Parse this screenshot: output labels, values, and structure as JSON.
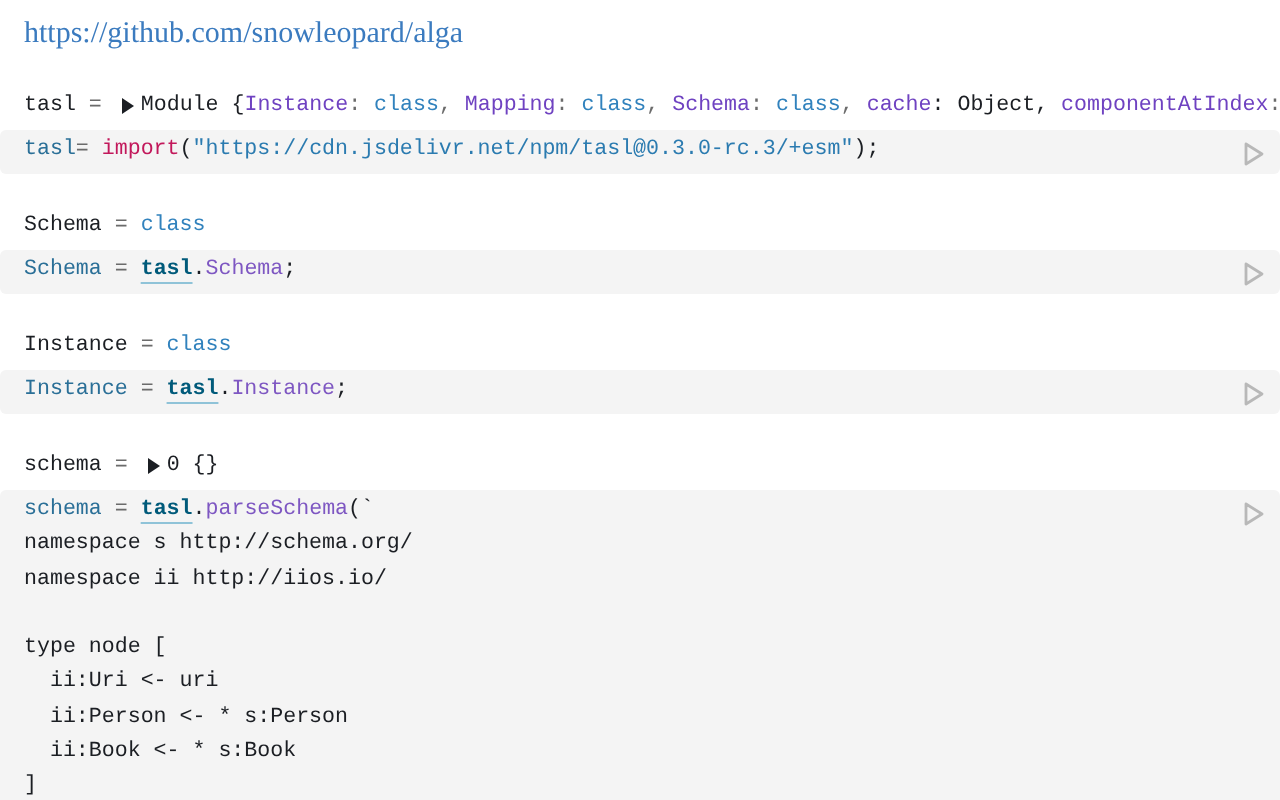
{
  "link": "https://github.com/snowleopard/alga",
  "cells": [
    {
      "output": {
        "label": [
          {
            "text": "tasl",
            "kind": "plain"
          },
          {
            "text": " = ",
            "kind": "op"
          }
        ],
        "expanded": false,
        "value": [
          {
            "text": "Module {",
            "kind": "plain"
          },
          {
            "text": "Instance",
            "kind": "key"
          },
          {
            "text": ": ",
            "kind": "op"
          },
          {
            "text": "class",
            "kind": "value"
          },
          {
            "text": ", ",
            "kind": "op"
          },
          {
            "text": "Mapping",
            "kind": "key"
          },
          {
            "text": ": ",
            "kind": "op"
          },
          {
            "text": "class",
            "kind": "value"
          },
          {
            "text": ", ",
            "kind": "op"
          },
          {
            "text": "Schema",
            "kind": "key"
          },
          {
            "text": ": ",
            "kind": "op"
          },
          {
            "text": "class",
            "kind": "value"
          },
          {
            "text": ", ",
            "kind": "op"
          },
          {
            "text": "cache",
            "kind": "key"
          },
          {
            "text": ": Object, ",
            "kind": "plain"
          },
          {
            "text": "componentAtIndex",
            "kind": "key"
          },
          {
            "text": ":",
            "kind": "op"
          }
        ]
      },
      "code": [
        [
          [
            {
              "text": "tasl",
              "kind": "var"
            },
            {
              "text": "= ",
              "kind": "op"
            },
            {
              "text": "import",
              "kind": "keyword"
            },
            {
              "text": "(",
              "kind": "plain"
            },
            {
              "text": "\"https://cdn.jsdelivr.net/npm/tasl@0.3.0-rc.3/+esm\"",
              "kind": "string"
            },
            {
              "text": ");",
              "kind": "plain"
            }
          ]
        ]
      ]
    },
    {
      "output": {
        "label": [
          {
            "text": "Schema",
            "kind": "plain"
          },
          {
            "text": " = ",
            "kind": "op"
          }
        ],
        "value": [
          {
            "text": "class",
            "kind": "value"
          }
        ]
      },
      "code": [
        [
          [
            {
              "text": "Schema",
              "kind": "var"
            },
            {
              "text": " = ",
              "kind": "op"
            },
            {
              "text": "tasl",
              "kind": "ref"
            },
            {
              "text": ".",
              "kind": "plain"
            },
            {
              "text": "Schema",
              "kind": "prop"
            },
            {
              "text": ";",
              "kind": "plain"
            }
          ]
        ]
      ]
    },
    {
      "output": {
        "label": [
          {
            "text": "Instance",
            "kind": "plain"
          },
          {
            "text": " = ",
            "kind": "op"
          }
        ],
        "value": [
          {
            "text": "class",
            "kind": "value"
          }
        ]
      },
      "code": [
        [
          [
            {
              "text": "Instance",
              "kind": "var"
            },
            {
              "text": " = ",
              "kind": "op"
            },
            {
              "text": "tasl",
              "kind": "ref"
            },
            {
              "text": ".",
              "kind": "plain"
            },
            {
              "text": "Instance",
              "kind": "prop"
            },
            {
              "text": ";",
              "kind": "plain"
            }
          ]
        ]
      ]
    },
    {
      "output": {
        "label": [
          {
            "text": "schema",
            "kind": "plain"
          },
          {
            "text": " = ",
            "kind": "op"
          }
        ],
        "expanded": false,
        "value": [
          {
            "text": "0 {}",
            "kind": "plain"
          }
        ]
      },
      "code": [
        [
          [
            {
              "text": "schema",
              "kind": "var"
            },
            {
              "text": " = ",
              "kind": "op"
            },
            {
              "text": "tasl",
              "kind": "ref"
            },
            {
              "text": ".",
              "kind": "plain"
            },
            {
              "text": "parseSchema",
              "kind": "prop"
            },
            {
              "text": "(`",
              "kind": "plain"
            }
          ],
          [
            {
              "text": "namespace s http://schema.org/",
              "kind": "plain"
            }
          ],
          [
            {
              "text": "namespace ii http://iios.io/",
              "kind": "plain"
            }
          ]
        ],
        [
          [
            {
              "text": "type node [",
              "kind": "plain"
            }
          ],
          [
            {
              "text": "  ii:Uri <- uri",
              "kind": "plain"
            }
          ],
          [
            {
              "text": "  ii:Person <- * s:Person",
              "kind": "plain"
            }
          ],
          [
            {
              "text": "  ii:Book <- * s:Book",
              "kind": "plain"
            }
          ],
          [
            {
              "text": "]",
              "kind": "plain"
            }
          ]
        ]
      ]
    }
  ]
}
